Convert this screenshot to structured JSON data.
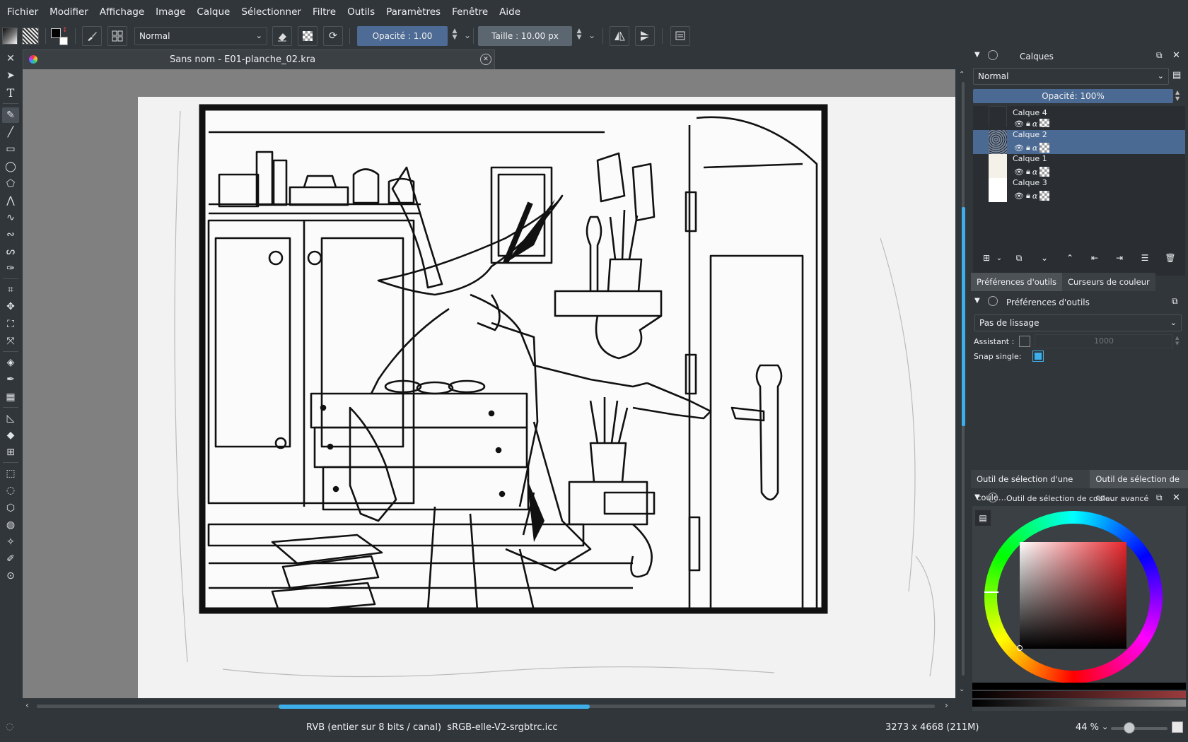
{
  "menu": [
    "Fichier",
    "Modifier",
    "Affichage",
    "Image",
    "Calque",
    "Sélectionner",
    "Filtre",
    "Outils",
    "Paramètres",
    "Fenêtre",
    "Aide"
  ],
  "toolbar": {
    "blend_mode": "Normal",
    "opacity_label": "Opacité : 1.00",
    "size_label": "Taille : 10.00 px"
  },
  "document": {
    "tab_title": "Sans nom - E01-planche_02.kra"
  },
  "status": {
    "color_profile": "RVB (entier sur 8 bits / canal)  sRGB-elle-V2-srgbtrc.icc",
    "image_size": "3273 x 4668 (211M)",
    "zoom": "44 %"
  },
  "layers_panel": {
    "title": "Calques",
    "blend_mode": "Normal",
    "opacity_label": "Opacité:  100%",
    "layers": [
      {
        "name": "Calque 4",
        "selected": false
      },
      {
        "name": "Calque 2",
        "selected": true
      },
      {
        "name": "Calque 1",
        "selected": false
      },
      {
        "name": "Calque 3",
        "selected": false
      }
    ]
  },
  "tool_options": {
    "tabs": [
      "Préférences d'outils",
      "Curseurs de couleur"
    ],
    "title": "Préférences d'outils",
    "smoothing": "Pas de lissage",
    "assistant_label": "Assistant :",
    "assistant_value": "1000",
    "snap_label": "Snap single:",
    "snap_checked": true
  },
  "color_panel": {
    "tabs": [
      "Outil de sélection d'une coule...",
      "Outil de sélection de co..."
    ],
    "title": "Outil de sélection de couleur avancé",
    "hue_color": "#e8262c"
  }
}
